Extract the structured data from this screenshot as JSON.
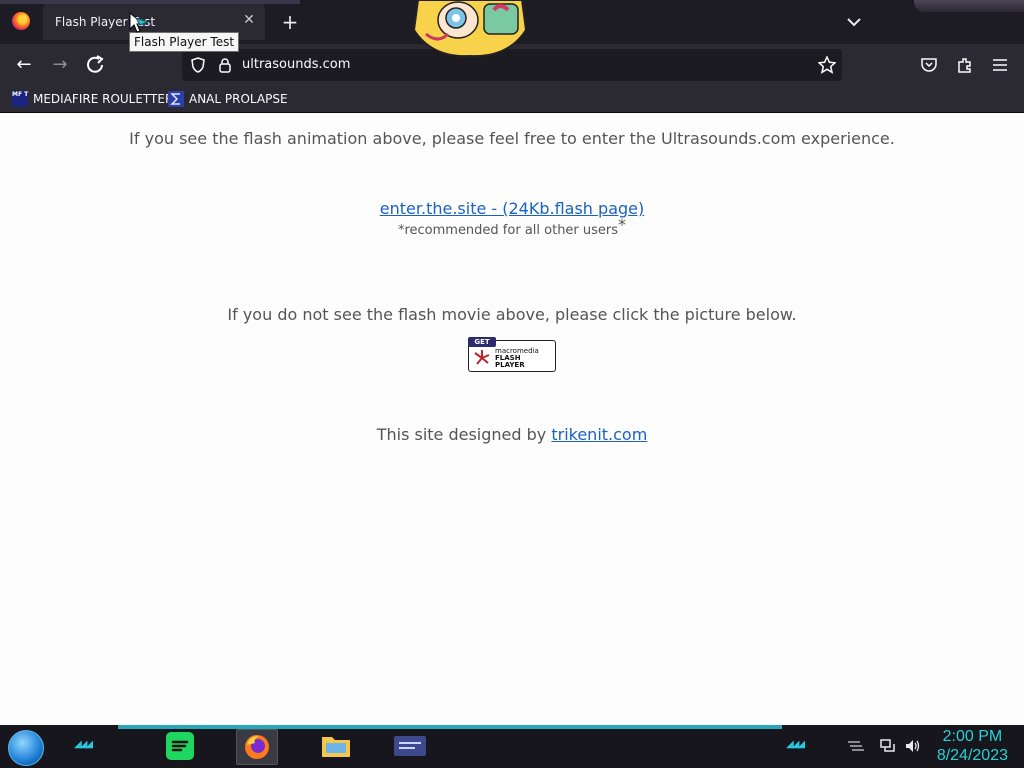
{
  "browser": {
    "tab_title": "Flash Player Test",
    "tooltip": "Flash Player Test",
    "url": "ultrasounds.com",
    "bookmarks": [
      {
        "label": "MEDIAFIRE ROULETTER",
        "icon_text": "MF T"
      },
      {
        "label": "ANAL PROLAPSE"
      }
    ]
  },
  "page": {
    "intro": "If you see the flash animation above, please feel free to enter the Ultrasounds.com experience.",
    "enter_link": "enter.the.site - (24Kb.flash page)",
    "recommend": "*recommended for all other users",
    "recommend_star": "*",
    "no_movie": "If you do not see the flash movie above, please click the picture below.",
    "badge": {
      "get": "GET",
      "line1": "macromedia",
      "line2": "FLASH",
      "line3": "PLAYER"
    },
    "designed_prefix": "This site designed by ",
    "designed_link": "trikenit.com"
  },
  "taskbar": {
    "time": "2:00 PM",
    "date": "8/24/2023"
  },
  "colors": {
    "accent_teal": "#27d0d8",
    "link_blue": "#1a61c7",
    "chrome_dark": "#2b2a33"
  }
}
